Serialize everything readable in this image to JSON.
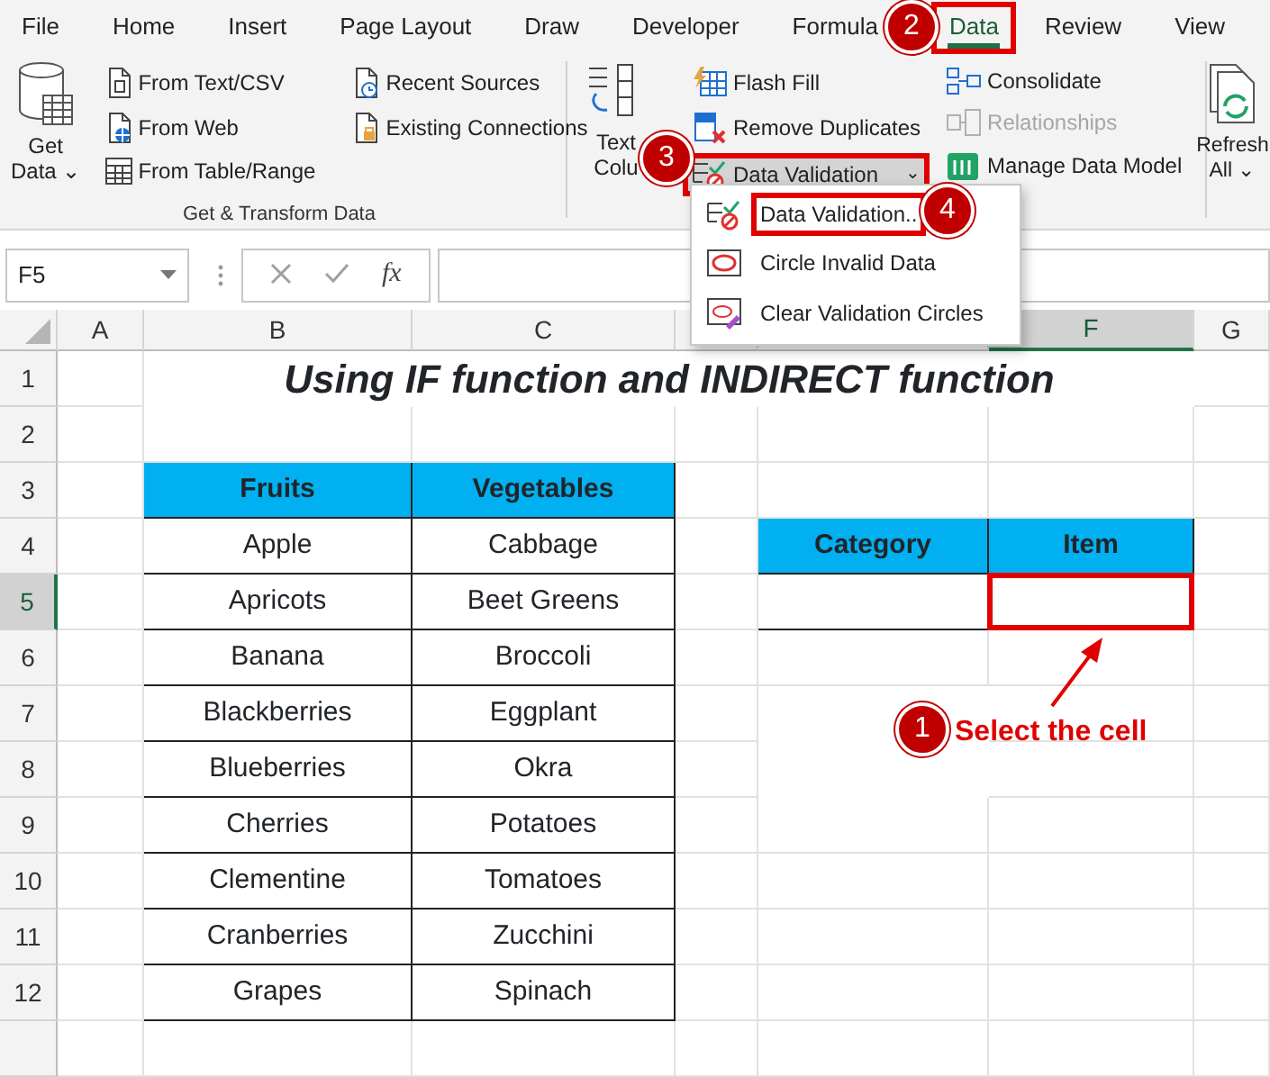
{
  "ribbon_tabs": [
    {
      "label": "File",
      "selected": false,
      "framed": false
    },
    {
      "label": "Home",
      "selected": false,
      "framed": false
    },
    {
      "label": "Insert",
      "selected": false,
      "framed": false
    },
    {
      "label": "Page Layout",
      "selected": false,
      "framed": false
    },
    {
      "label": "Draw",
      "selected": false,
      "framed": false
    },
    {
      "label": "Developer",
      "selected": false,
      "framed": false
    },
    {
      "label": "Formula",
      "selected": false,
      "framed": false
    },
    {
      "label": "Data",
      "selected": true,
      "framed": true
    },
    {
      "label": "Review",
      "selected": false,
      "framed": false
    },
    {
      "label": "View",
      "selected": false,
      "framed": false
    }
  ],
  "get_transform_group": {
    "label": "Get & Transform Data",
    "get_data": {
      "line_1": "Get",
      "line_2": "Data",
      "caret": "⌄"
    },
    "commands": [
      {
        "label": "From Text/CSV",
        "disabled": false
      },
      {
        "label": "From Web",
        "disabled": false
      },
      {
        "label": "From Table/Range",
        "disabled": false
      },
      {
        "label": "Recent Sources",
        "disabled": false
      },
      {
        "label": "Existing Connections",
        "disabled": false
      }
    ]
  },
  "data_tools_group": {
    "text_to_columns": {
      "line_1": "Text",
      "line_2": "Colu"
    },
    "commands": [
      {
        "label": "Flash Fill",
        "disabled": false,
        "framed": false
      },
      {
        "label": "Remove Duplicates",
        "disabled": false,
        "framed": false
      },
      {
        "label": "Data Validation",
        "disabled": false,
        "framed": true,
        "caret": "⌄"
      },
      {
        "label": "Consolidate",
        "disabled": false,
        "framed": false
      },
      {
        "label": "Relationships",
        "disabled": true,
        "framed": false
      },
      {
        "label": "Manage Data Model",
        "disabled": false,
        "framed": false
      }
    ]
  },
  "refresh_all": {
    "line_1": "Refresh",
    "line_2": "All",
    "caret": "⌄"
  },
  "validation_menu": [
    {
      "label": "Data Validation..",
      "framed": true
    },
    {
      "label": "Circle Invalid Data",
      "framed": false
    },
    {
      "label": "Clear Validation Circles",
      "framed": false
    }
  ],
  "formula_bar": {
    "name_box": "F5",
    "fx": "fx"
  },
  "sheet": {
    "columns": [
      {
        "label": "A",
        "selected": false
      },
      {
        "label": "B",
        "selected": false
      },
      {
        "label": "C",
        "selected": false
      },
      {
        "selected": false
      },
      {
        "selected": false
      },
      {
        "label": "F",
        "selected": true
      },
      {
        "label": "G",
        "selected": false
      }
    ],
    "rows": [
      {
        "label": "1",
        "selected": false
      },
      {
        "label": "2",
        "selected": false
      },
      {
        "label": "3",
        "selected": false
      },
      {
        "label": "4",
        "selected": false
      },
      {
        "label": "5",
        "selected": true
      },
      {
        "label": "6",
        "selected": false
      },
      {
        "label": "7",
        "selected": false
      },
      {
        "label": "8",
        "selected": false
      },
      {
        "label": "9",
        "selected": false
      },
      {
        "label": "10",
        "selected": false
      },
      {
        "label": "11",
        "selected": false
      },
      {
        "label": "12",
        "selected": false
      }
    ],
    "title": "Using IF function and INDIRECT function",
    "produce_table": {
      "columns": [
        "Fruits",
        "Vegetables"
      ],
      "rows": [
        [
          "Apple",
          "Cabbage"
        ],
        [
          "Apricots",
          "Beet Greens"
        ],
        [
          "Banana",
          "Broccoli"
        ],
        [
          "Blackberries",
          "Eggplant"
        ],
        [
          "Blueberries",
          "Okra"
        ],
        [
          "Cherries",
          "Potatoes"
        ],
        [
          "Clementine",
          "Tomatoes"
        ],
        [
          "Cranberries",
          "Zucchini"
        ],
        [
          "Grapes",
          "Spinach"
        ]
      ]
    },
    "lookup_table": {
      "columns": [
        "Category",
        "Item"
      ],
      "value_cells": [
        {
          "framed": false
        },
        {
          "framed": true
        }
      ]
    }
  },
  "annotations": [
    {
      "number": "1",
      "text": "Select the cell"
    },
    {
      "number": "2"
    },
    {
      "number": "3"
    },
    {
      "number": "4"
    }
  ]
}
